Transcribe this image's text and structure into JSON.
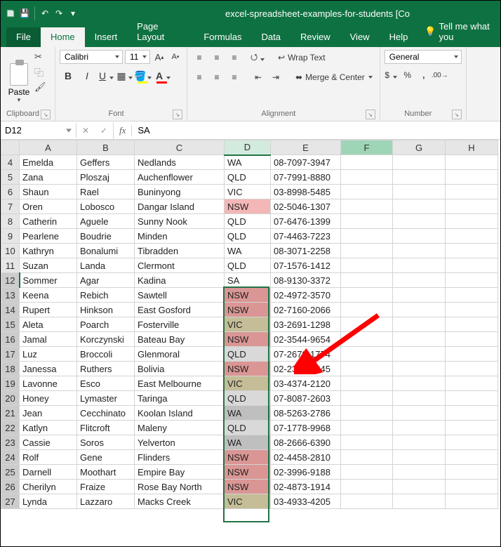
{
  "titlebar": {
    "title": "excel-spreadsheet-examples-for-students  [Co"
  },
  "tabs": {
    "file": "File",
    "home": "Home",
    "insert": "Insert",
    "pagelayout": "Page Layout",
    "formulas": "Formulas",
    "data": "Data",
    "review": "Review",
    "view": "View",
    "help": "Help",
    "tellme": "Tell me what you"
  },
  "ribbon": {
    "clipboard": {
      "paste": "Paste",
      "label": "Clipboard"
    },
    "font": {
      "name": "Calibri",
      "size": "11",
      "label": "Font"
    },
    "alignment": {
      "wrap": "Wrap Text",
      "merge": "Merge & Center",
      "label": "Alignment"
    },
    "number": {
      "format": "General",
      "label": "Number"
    }
  },
  "formulabar": {
    "namebox": "D12",
    "value": "SA"
  },
  "columns": [
    "A",
    "B",
    "C",
    "D",
    "E",
    "F",
    "G",
    "H"
  ],
  "row_start": 4,
  "rows": [
    {
      "n": 4,
      "a": "Emelda",
      "b": "Geffers",
      "c": "Nedlands",
      "d": "WA",
      "e": "08-7097-3947"
    },
    {
      "n": 5,
      "a": "Zana",
      "b": "Ploszaj",
      "c": "Auchenflower",
      "d": "QLD",
      "e": "07-7991-8880"
    },
    {
      "n": 6,
      "a": "Shaun",
      "b": "Rael",
      "c": "Buninyong",
      "d": "VIC",
      "e": "03-8998-5485"
    },
    {
      "n": 7,
      "a": "Oren",
      "b": "Lobosco",
      "c": "Dangar Island",
      "d": "NSW",
      "e": "02-5046-1307"
    },
    {
      "n": 8,
      "a": "Catherin",
      "b": "Aguele",
      "c": "Sunny Nook",
      "d": "QLD",
      "e": "07-6476-1399"
    },
    {
      "n": 9,
      "a": "Pearlene",
      "b": "Boudrie",
      "c": "Minden",
      "d": "QLD",
      "e": "07-4463-7223"
    },
    {
      "n": 10,
      "a": "Kathryn",
      "b": "Bonalumi",
      "c": "Tibradden",
      "d": "WA",
      "e": "08-3071-2258"
    },
    {
      "n": 11,
      "a": "Suzan",
      "b": "Landa",
      "c": "Clermont",
      "d": "QLD",
      "e": "07-1576-1412"
    },
    {
      "n": 12,
      "a": "Sommer",
      "b": "Agar",
      "c": "Kadina",
      "d": "SA",
      "e": "08-9130-3372"
    },
    {
      "n": 13,
      "a": "Keena",
      "b": "Rebich",
      "c": "Sawtell",
      "d": "NSW",
      "e": "02-4972-3570"
    },
    {
      "n": 14,
      "a": "Rupert",
      "b": "Hinkson",
      "c": "East Gosford",
      "d": "NSW",
      "e": "02-7160-2066"
    },
    {
      "n": 15,
      "a": "Aleta",
      "b": "Poarch",
      "c": "Fosterville",
      "d": "VIC",
      "e": "03-2691-1298"
    },
    {
      "n": 16,
      "a": "Jamal",
      "b": "Korczynski",
      "c": "Bateau Bay",
      "d": "NSW",
      "e": "02-3544-9654"
    },
    {
      "n": 17,
      "a": "Luz",
      "b": "Broccoli",
      "c": "Glenmoral",
      "d": "QLD",
      "e": "07-2679-1774"
    },
    {
      "n": 18,
      "a": "Janessa",
      "b": "Ruthers",
      "c": "Bolivia",
      "d": "NSW",
      "e": "02-2367-6845"
    },
    {
      "n": 19,
      "a": "Lavonne",
      "b": "Esco",
      "c": "East Melbourne",
      "d": "VIC",
      "e": "03-4374-2120"
    },
    {
      "n": 20,
      "a": "Honey",
      "b": "Lymaster",
      "c": "Taringa",
      "d": "QLD",
      "e": "07-8087-2603"
    },
    {
      "n": 21,
      "a": "Jean",
      "b": "Cecchinato",
      "c": "Koolan Island",
      "d": "WA",
      "e": "08-5263-2786"
    },
    {
      "n": 22,
      "a": "Katlyn",
      "b": "Flitcroft",
      "c": "Maleny",
      "d": "QLD",
      "e": "07-1778-9968"
    },
    {
      "n": 23,
      "a": "Cassie",
      "b": "Soros",
      "c": "Yelverton",
      "d": "WA",
      "e": "08-2666-6390"
    },
    {
      "n": 24,
      "a": "Rolf",
      "b": "Gene",
      "c": "Flinders",
      "d": "NSW",
      "e": "02-4458-2810"
    },
    {
      "n": 25,
      "a": "Darnell",
      "b": "Moothart",
      "c": "Empire Bay",
      "d": "NSW",
      "e": "02-3996-9188"
    },
    {
      "n": 26,
      "a": "Cherilyn",
      "b": "Fraize",
      "c": "Rose Bay North",
      "d": "NSW",
      "e": "02-4873-1914"
    },
    {
      "n": 27,
      "a": "Lynda",
      "b": "Lazzaro",
      "c": "Macks Creek",
      "d": "VIC",
      "e": "03-4933-4205"
    }
  ],
  "selection": {
    "col": "D",
    "row_from": 12,
    "row_to": 27,
    "active_row": 12
  },
  "highlight_map": {
    "NSW": "hl-nsw",
    "QLD": "hl-qld",
    "VIC": "hl-vic",
    "WA": "hl-wa"
  }
}
